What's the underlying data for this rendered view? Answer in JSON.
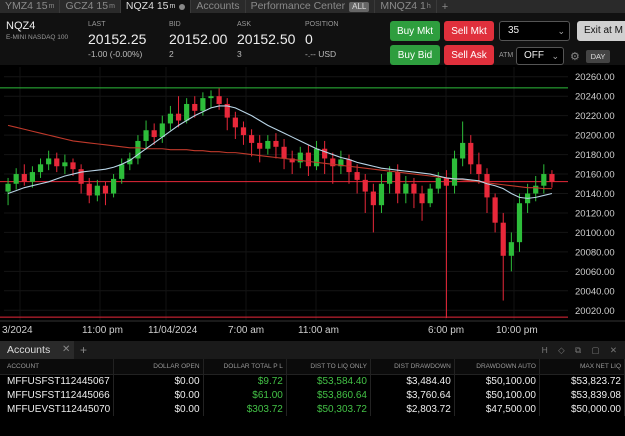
{
  "tabs": [
    {
      "label": "YMZ4 15",
      "sup": "m",
      "active": false
    },
    {
      "label": "GCZ4 15",
      "sup": "m",
      "active": false
    },
    {
      "label": "NQZ4 15",
      "sup": "m",
      "active": true
    },
    {
      "label": "Accounts",
      "active": false
    },
    {
      "label": "Performance Center",
      "badge": "ALL",
      "active": false
    },
    {
      "label": "MNQZ4 1",
      "sup": "h",
      "active": false
    }
  ],
  "quote": {
    "symbol": "NQZ4",
    "description": "E-MINI NASDAQ 100",
    "last_label": "LAST",
    "last_value": "20152.25",
    "last_change": "-1.00 (-0.00%)",
    "bid_label": "BID",
    "bid_value": "20152.00",
    "bid_size": "2",
    "ask_label": "ASK",
    "ask_value": "20152.50",
    "ask_size": "3",
    "position_label": "POSITION",
    "position_value": "0",
    "position_pnl": "-.-- USD"
  },
  "order": {
    "buy_mkt": "Buy Mkt",
    "sell_mkt": "Sell Mkt",
    "buy_bid": "Buy Bid",
    "sell_ask": "Sell Ask",
    "quantity": "35",
    "exit_label": "Exit at M",
    "atm_label": "ATM",
    "atm_value": "OFF",
    "day_label": "DAY"
  },
  "colors": {
    "buy": "#2e9e3e",
    "sell": "#e0303c",
    "up_candle": "#2dbd3a",
    "down_candle": "#e8283a",
    "price_line": "#e8283a",
    "high_line": "#2dbd3a"
  },
  "chart_data": {
    "type": "candlestick",
    "y_ticks": [
      20020.0,
      20040.0,
      20060.0,
      20080.0,
      20100.0,
      20120.0,
      20140.0,
      20160.0,
      20180.0,
      20200.0,
      20220.0,
      20240.0,
      20260.0
    ],
    "ylim": [
      20010,
      20270
    ],
    "x_ticks": [
      "3/2024",
      "11:00 pm",
      "11/04/2024",
      "7:00 am",
      "11:00 am",
      "6:00 pm",
      "10:00 pm"
    ],
    "price_markers": [
      {
        "label": "20248.50",
        "value": 20248.5,
        "color": "#2dbd3a"
      },
      {
        "label": "20152.25",
        "value": 20152.25,
        "color": "#e8283a"
      },
      {
        "label": "20013.00",
        "value": 20013.0,
        "color": "#e8283a"
      }
    ],
    "candles": [
      [
        20142,
        20150,
        20128,
        20156
      ],
      [
        20150,
        20160,
        20144,
        20166
      ],
      [
        20160,
        20152,
        20148,
        20170
      ],
      [
        20152,
        20162,
        20146,
        20168
      ],
      [
        20162,
        20170,
        20156,
        20176
      ],
      [
        20170,
        20176,
        20164,
        20184
      ],
      [
        20176,
        20168,
        20162,
        20182
      ],
      [
        20168,
        20172,
        20160,
        20180
      ],
      [
        20172,
        20165,
        20158,
        20176
      ],
      [
        20165,
        20150,
        20140,
        20170
      ],
      [
        20150,
        20138,
        20130,
        20156
      ],
      [
        20138,
        20148,
        20132,
        20154
      ],
      [
        20148,
        20140,
        20128,
        20152
      ],
      [
        20140,
        20155,
        20136,
        20160
      ],
      [
        20155,
        20170,
        20150,
        20176
      ],
      [
        20170,
        20176,
        20164,
        20182
      ],
      [
        20176,
        20194,
        20170,
        20200
      ],
      [
        20194,
        20205,
        20185,
        20215
      ],
      [
        20205,
        20198,
        20190,
        20212
      ],
      [
        20198,
        20212,
        20192,
        20220
      ],
      [
        20212,
        20222,
        20205,
        20230
      ],
      [
        20222,
        20215,
        20208,
        20240
      ],
      [
        20215,
        20232,
        20212,
        20238
      ],
      [
        20232,
        20225,
        20218,
        20240
      ],
      [
        20225,
        20238,
        20220,
        20244
      ],
      [
        20238,
        20240,
        20228,
        20246
      ],
      [
        20240,
        20232,
        20226,
        20248
      ],
      [
        20232,
        20218,
        20205,
        20238
      ],
      [
        20218,
        20208,
        20196,
        20224
      ],
      [
        20208,
        20200,
        20190,
        20214
      ],
      [
        20200,
        20192,
        20178,
        20206
      ],
      [
        20192,
        20186,
        20172,
        20200
      ],
      [
        20186,
        20194,
        20180,
        20200
      ],
      [
        20194,
        20188,
        20176,
        20202
      ],
      [
        20188,
        20176,
        20165,
        20196
      ],
      [
        20176,
        20172,
        20160,
        20184
      ],
      [
        20172,
        20182,
        20166,
        20188
      ],
      [
        20182,
        20168,
        20158,
        20190
      ],
      [
        20168,
        20186,
        20164,
        20194
      ],
      [
        20186,
        20176,
        20160,
        20194
      ],
      [
        20176,
        20168,
        20150,
        20182
      ],
      [
        20168,
        20175,
        20160,
        20184
      ],
      [
        20175,
        20162,
        20150,
        20180
      ],
      [
        20162,
        20154,
        20140,
        20170
      ],
      [
        20154,
        20142,
        20120,
        20160
      ],
      [
        20142,
        20128,
        20100,
        20150
      ],
      [
        20128,
        20150,
        20120,
        20160
      ],
      [
        20150,
        20162,
        20140,
        20168
      ],
      [
        20162,
        20140,
        20130,
        20170
      ],
      [
        20140,
        20150,
        20130,
        20158
      ],
      [
        20150,
        20140,
        20125,
        20156
      ],
      [
        20140,
        20130,
        20112,
        20148
      ],
      [
        20130,
        20145,
        20126,
        20150
      ],
      [
        20145,
        20156,
        20140,
        20162
      ],
      [
        20156,
        20148,
        20012,
        20164
      ],
      [
        20148,
        20176,
        20140,
        20184
      ],
      [
        20176,
        20192,
        20168,
        20214
      ],
      [
        20192,
        20170,
        20160,
        20200
      ],
      [
        20170,
        20160,
        20150,
        20182
      ],
      [
        20160,
        20136,
        20120,
        20166
      ],
      [
        20136,
        20110,
        20100,
        20140
      ],
      [
        20110,
        20076,
        20030,
        20120
      ],
      [
        20076,
        20090,
        20060,
        20100
      ],
      [
        20090,
        20130,
        20080,
        20140
      ],
      [
        20130,
        20140,
        20120,
        20150
      ],
      [
        20140,
        20148,
        20132,
        20158
      ],
      [
        20148,
        20160,
        20140,
        20170
      ],
      [
        20160,
        20152,
        20146,
        20164
      ]
    ],
    "ma_fast": [
      20140,
      20143,
      20146,
      20148,
      20150,
      20152,
      20155,
      20158,
      20160,
      20162,
      20163,
      20164,
      20165,
      20167,
      20170,
      20174,
      20180,
      20186,
      20192,
      20198,
      20204,
      20210,
      20215,
      20220,
      20224,
      20228,
      20230,
      20230,
      20228,
      20224,
      20220,
      20215,
      20210,
      20206,
      20202,
      20198,
      20194,
      20190,
      20186,
      20183,
      20180,
      20177,
      20175,
      20172,
      20170,
      20168,
      20166,
      20165,
      20164,
      20163,
      20162,
      20161,
      20160,
      20158,
      20156,
      20155,
      20155,
      20154,
      20153,
      20150,
      20148,
      20145,
      20140,
      20136,
      20135,
      20136,
      20138,
      20140
    ],
    "ma_slow": [
      20210,
      20208,
      20206,
      20204,
      20202,
      20200,
      20198,
      20196,
      20194,
      20193,
      20192,
      20191,
      20190,
      20189,
      20188,
      20187,
      20187,
      20186,
      20186,
      20186,
      20185,
      20185,
      20185,
      20184,
      20184,
      20183,
      20183,
      20182,
      20182,
      20181,
      20180,
      20179,
      20178,
      20177,
      20176,
      20175,
      20174,
      20173,
      20172,
      20171,
      20170,
      20169,
      20168,
      20167,
      20166,
      20165,
      20164,
      20163,
      20162,
      20161,
      20160,
      20159,
      20158,
      20157,
      20156,
      20155,
      20154,
      20153,
      20152,
      20151,
      20150,
      20149,
      20148,
      20147,
      20146,
      20146,
      20145,
      20145
    ]
  },
  "accounts": {
    "tab_label": "Accounts",
    "columns": [
      "ACCOUNT",
      "DOLLAR OPEN",
      "DOLLAR TOTAL P L",
      "DIST TO LIQ ONLY",
      "DIST DRAWDOWN",
      "DRAWDOWN AUTO",
      "MAX NET LIQ"
    ],
    "rows": [
      [
        "MFFUSFST112445067",
        "$0.00",
        "$9.72",
        "$53,584.40",
        "$3,484.40",
        "$50,100.00",
        "$53,823.72"
      ],
      [
        "MFFUSFST112445066",
        "$0.00",
        "$61.00",
        "$53,860.64",
        "$3,760.64",
        "$50,100.00",
        "$53,839.08"
      ],
      [
        "MFFUEVST112445070",
        "$0.00",
        "$303.72",
        "$50,303.72",
        "$2,803.72",
        "$47,500.00",
        "$50,000.00"
      ]
    ]
  }
}
